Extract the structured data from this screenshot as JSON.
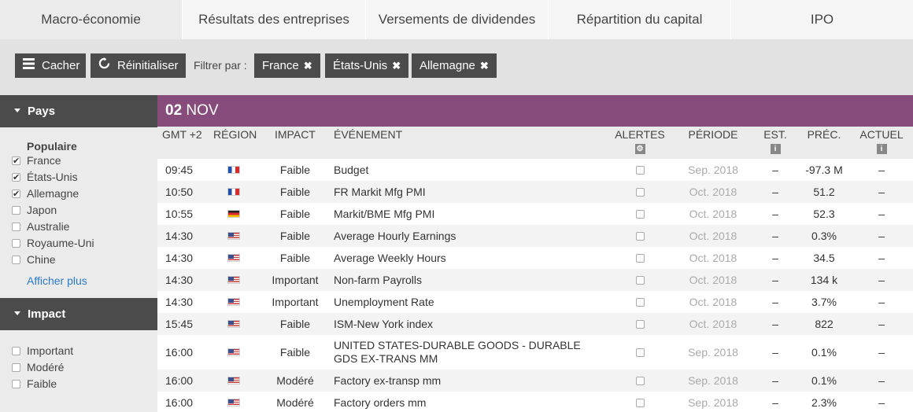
{
  "tabs": [
    "Macro-économie",
    "Résultats des entreprises",
    "Versements de dividendes",
    "Répartition du capital",
    "IPO"
  ],
  "toolbar": {
    "hide_label": "Cacher",
    "reset_label": "Réinitialiser",
    "filter_label": "Filtrer par :",
    "chips": [
      "France",
      "États-Unis",
      "Allemagne"
    ]
  },
  "sidebar": {
    "country_section": "Pays",
    "popular_title": "Populaire",
    "countries": [
      {
        "label": "France",
        "checked": true
      },
      {
        "label": "États-Unis",
        "checked": true
      },
      {
        "label": "Allemagne",
        "checked": true
      },
      {
        "label": "Japon",
        "checked": false
      },
      {
        "label": "Australie",
        "checked": false
      },
      {
        "label": "Royaume-Uni",
        "checked": false
      },
      {
        "label": "Chine",
        "checked": false
      }
    ],
    "show_more": "Afficher plus",
    "impact_section": "Impact",
    "impacts": [
      {
        "label": "Important",
        "checked": false
      },
      {
        "label": "Modéré",
        "checked": false
      },
      {
        "label": "Faible",
        "checked": false
      }
    ]
  },
  "calendar": {
    "date_day": "02",
    "date_month": "NOV",
    "headers": {
      "time": "GMT +2",
      "region": "RÉGION",
      "impact": "IMPACT",
      "event": "ÉVÉNEMENT",
      "alerts": "ALERTES",
      "period": "PÉRIODE",
      "est": "EST.",
      "prev": "PRÉC.",
      "actual": "ACTUEL"
    },
    "rows": [
      {
        "time": "09:45",
        "flag": "fr",
        "impact": "Faible",
        "event": "Budget",
        "period": "Sep. 2018",
        "est": "–",
        "prev": "-97.3 M",
        "actual": "–"
      },
      {
        "time": "10:50",
        "flag": "fr",
        "impact": "Faible",
        "event": "FR Markit Mfg PMI",
        "period": "Oct. 2018",
        "est": "–",
        "prev": "51.2",
        "actual": "–"
      },
      {
        "time": "10:55",
        "flag": "de",
        "impact": "Faible",
        "event": "Markit/BME Mfg PMI",
        "period": "Oct. 2018",
        "est": "–",
        "prev": "52.3",
        "actual": "–"
      },
      {
        "time": "14:30",
        "flag": "us",
        "impact": "Faible",
        "event": "Average Hourly Earnings",
        "period": "Oct. 2018",
        "est": "–",
        "prev": "0.3%",
        "actual": "–"
      },
      {
        "time": "14:30",
        "flag": "us",
        "impact": "Faible",
        "event": "Average Weekly Hours",
        "period": "Oct. 2018",
        "est": "–",
        "prev": "34.5",
        "actual": "–"
      },
      {
        "time": "14:30",
        "flag": "us",
        "impact": "Important",
        "event": "Non-farm Payrolls",
        "period": "Oct. 2018",
        "est": "–",
        "prev": "134 k",
        "actual": "–"
      },
      {
        "time": "14:30",
        "flag": "us",
        "impact": "Important",
        "event": "Unemployment Rate",
        "period": "Oct. 2018",
        "est": "–",
        "prev": "3.7%",
        "actual": "–"
      },
      {
        "time": "15:45",
        "flag": "us",
        "impact": "Faible",
        "event": "ISM-New York index",
        "period": "Oct. 2018",
        "est": "–",
        "prev": "822",
        "actual": "–"
      },
      {
        "time": "16:00",
        "flag": "us",
        "impact": "Faible",
        "event": "UNITED STATES-DURABLE GOODS - DURABLE GDS EX-TRANS MM",
        "period": "Sep. 2018",
        "est": "–",
        "prev": "0.1%",
        "actual": "–"
      },
      {
        "time": "16:00",
        "flag": "us",
        "impact": "Modéré",
        "event": "Factory ex-transp mm",
        "period": "Sep. 2018",
        "est": "–",
        "prev": "0.1%",
        "actual": "–"
      },
      {
        "time": "16:00",
        "flag": "us",
        "impact": "Modéré",
        "event": "Factory orders mm",
        "period": "Sep. 2018",
        "est": "–",
        "prev": "2.3%",
        "actual": "–"
      }
    ]
  }
}
